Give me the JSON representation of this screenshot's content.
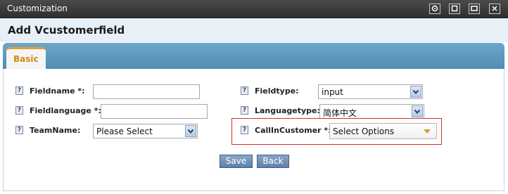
{
  "window": {
    "title": "Customization",
    "controls": [
      "settings-icon",
      "maximize-icon",
      "restore-icon",
      "close-icon"
    ]
  },
  "header": {
    "title": "Add Vcustomerfield"
  },
  "tabs": [
    {
      "label": "Basic",
      "active": true
    }
  ],
  "form": {
    "fieldname": {
      "label": "Fieldname *:",
      "value": ""
    },
    "fieldlanguage": {
      "label": "Fieldlanguage *:",
      "value": ""
    },
    "teamname": {
      "label": "TeamName:",
      "selected": "Please Select"
    },
    "fieldtype": {
      "label": "Fieldtype:",
      "selected": "input"
    },
    "languagetype": {
      "label": "Languagetype:",
      "selected": "简体中文"
    },
    "callincustomer": {
      "label": "CallInCustomer *:",
      "selected": "Select Options"
    },
    "help_glyph": "?"
  },
  "buttons": {
    "save": "Save",
    "back": "Back"
  },
  "colors": {
    "accent_tab": "#d08a10",
    "tabbar": "#5b97bb",
    "highlight": "#d03030",
    "button": "#6d8db5"
  }
}
